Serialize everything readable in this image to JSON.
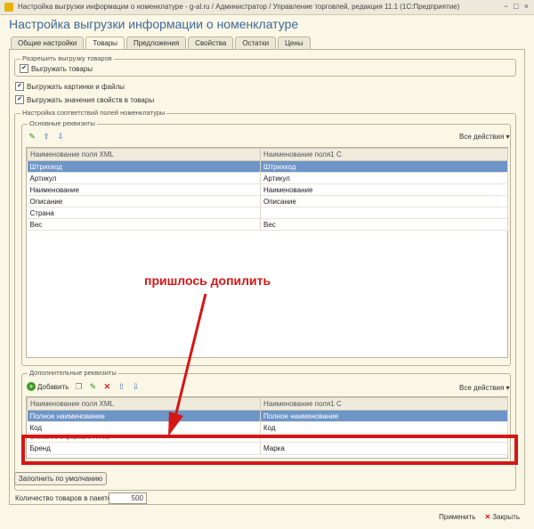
{
  "window": {
    "title": "Настройка выгрузки информации о номенклатуре - g-al.ru / Администратор / Управление торговлей, редакция 11.1  (1С:Предприятие)",
    "controls": [
      "−",
      "□",
      "×"
    ]
  },
  "heading": "Настройка выгрузки информации о номенклатуре",
  "tabs": [
    "Общие настройки",
    "Товары",
    "Предложения",
    "Свойства",
    "Остатки",
    "Цены"
  ],
  "active_tab": "Товары",
  "allow_group": {
    "title": "Разрешить выгрузку товаров",
    "checkbox": {
      "label": "Выгружать товары",
      "checked": true
    }
  },
  "options": [
    {
      "label": "Выгружать картинки и файлы",
      "checked": true
    },
    {
      "label": "Выгружать значения свойств в товары",
      "checked": true
    }
  ],
  "mapping_group": {
    "title": "Настройка соответствий полей номенклатуры"
  },
  "basic": {
    "title": "Основные реквизиты",
    "actions": "Все действия ▾",
    "columns": [
      "Наименование поля XML",
      "Наименование поля1 С"
    ],
    "rows": [
      [
        "Штрихкод",
        "Штрихкод"
      ],
      [
        "Артикул",
        "Артикул"
      ],
      [
        "Наименование",
        "Наименование"
      ],
      [
        "Описание",
        "Описание"
      ],
      [
        "Страна",
        ""
      ],
      [
        "Вес",
        "Вес"
      ]
    ],
    "selected_row": 0
  },
  "additional": {
    "title": "Дополнительные реквизиты",
    "add_label": "Добавить",
    "actions": "Все действия ▾",
    "columns": [
      "Наименование поля XML",
      "Наименование поля1 С"
    ],
    "rows": [
      [
        "Полное наименование",
        "Полное наименование"
      ],
      [
        "Код",
        "Код"
      ],
      [
        "Описание в формате HTML",
        ""
      ],
      [
        "Бренд",
        "Марка"
      ]
    ],
    "selected_row": 0
  },
  "fill_default": "Заполнить по умолчанию",
  "package": {
    "label": "Количество товаров в пакете:",
    "value": "500"
  },
  "footer": {
    "apply": "Применить",
    "close": "Закрыть"
  },
  "annotation": {
    "text": "пришлось допилить",
    "color": "#d61616"
  },
  "icons": {
    "edit": "pencil-icon",
    "up": "arrow-up-icon",
    "down": "arrow-down-icon",
    "add": "plus-icon",
    "copy": "copy-icon",
    "delete": "delete-icon",
    "close": "close-icon"
  }
}
